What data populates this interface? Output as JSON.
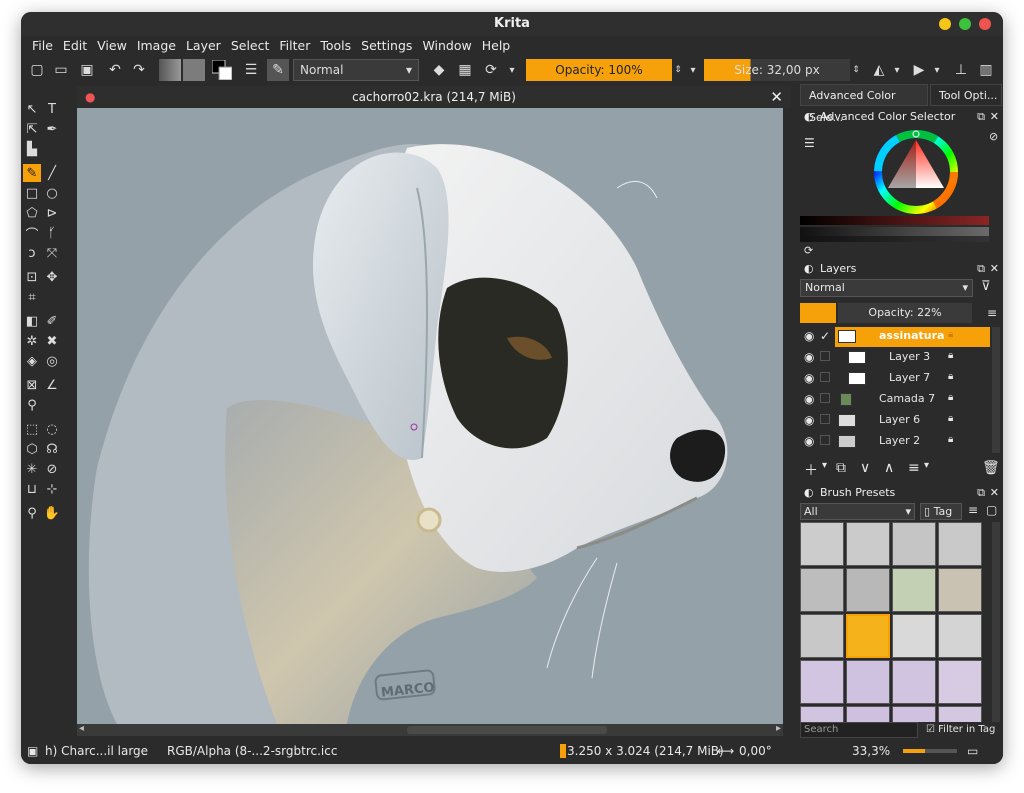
{
  "window": {
    "title": "Krita"
  },
  "menu": [
    "File",
    "Edit",
    "View",
    "Image",
    "Layer",
    "Select",
    "Filter",
    "Tools",
    "Settings",
    "Window",
    "Help"
  ],
  "toolbar": {
    "blend_mode": "Normal",
    "opacity_label": "Opacity: 100%",
    "size_label": "Size: 32,00 px"
  },
  "document": {
    "tab_title": "cachorro02.kra (214,7 MiB)"
  },
  "canvas": {
    "signature_text": "MARCO",
    "background": "#95a1a9"
  },
  "dock": {
    "tabs": [
      "Advanced Color Sele...",
      "Tool Opti..."
    ],
    "color_selector_title": "Advanced Color Selector",
    "layers": {
      "title": "Layers",
      "blend_mode": "Normal",
      "opacity_label": "Opacity: 22%",
      "items": [
        {
          "name": "assinatura",
          "active": true
        },
        {
          "name": "Layer 3",
          "active": false
        },
        {
          "name": "Layer 7",
          "active": false
        },
        {
          "name": "Camada 7",
          "active": false
        },
        {
          "name": "Layer 6",
          "active": false
        },
        {
          "name": "Layer 2",
          "active": false
        }
      ]
    },
    "brushes": {
      "title": "Brush Presets",
      "filter": "All",
      "tag_label": "Tag",
      "search_placeholder": "Search",
      "filter_in_tag": "Filter in Tag"
    }
  },
  "status": {
    "brush": "h) Charc...il large",
    "color_space": "RGB/Alpha (8-...2-srgbtrc.icc",
    "dimensions": "3.250 x 3.024 (214,7 MiB)",
    "rotation": "0,00°",
    "zoom": "33,3%"
  },
  "colors": {
    "accent": "#f7a10a",
    "bg": "#2b2b2b",
    "canvas": "#95a1a9"
  }
}
